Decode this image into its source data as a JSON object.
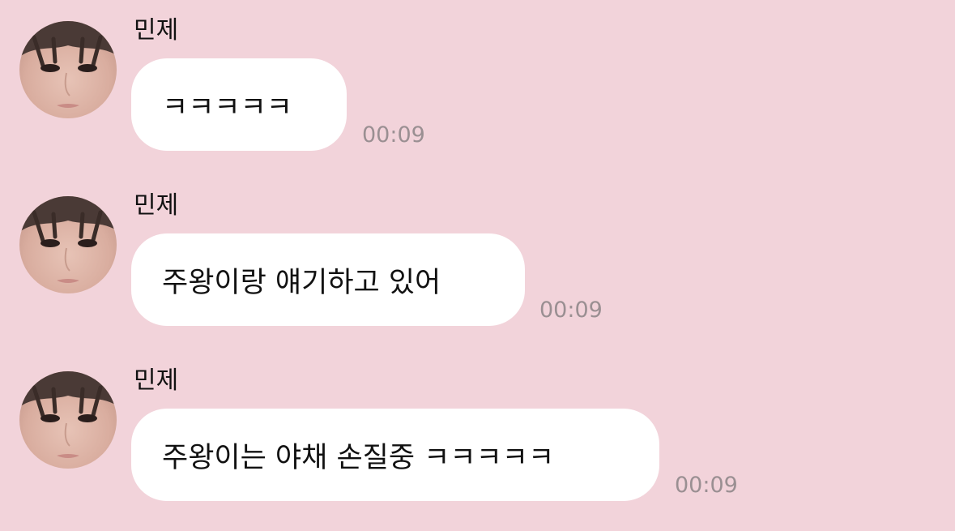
{
  "conversation": {
    "messages": [
      {
        "sender": "민제",
        "text": "ㅋㅋㅋㅋㅋ",
        "time": "00:09",
        "avatar_icon": "profile-photo"
      },
      {
        "sender": "민제",
        "text": "주왕이랑 얘기하고 있어",
        "time": "00:09",
        "avatar_icon": "profile-photo"
      },
      {
        "sender": "민제",
        "text": "주왕이는 야채 손질중 ㅋㅋㅋㅋㅋ",
        "time": "00:09",
        "avatar_icon": "profile-photo"
      }
    ]
  },
  "colors": {
    "background": "#f2d3da",
    "bubble": "#ffffff",
    "timestamp": "#9a8f92"
  }
}
